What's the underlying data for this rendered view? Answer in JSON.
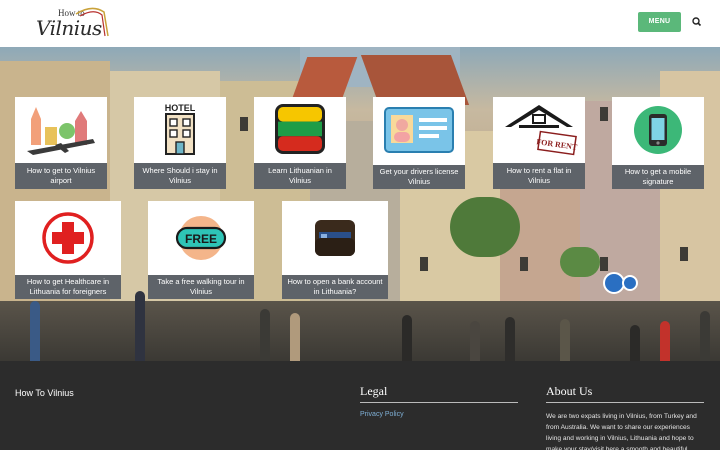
{
  "header": {
    "logo_small": "How to",
    "logo_big": "Vilnius",
    "menu_label": "MENU",
    "search_icon": "search-icon"
  },
  "tiles": [
    {
      "label": "How to get to Vilnius airport",
      "icon": "airport-skyline-icon"
    },
    {
      "label": "Where Should i stay in Vilnius",
      "icon": "hotel-icon",
      "icon_text": "HOTEL"
    },
    {
      "label": "Learn Lithuanian in Vilnius",
      "icon": "lithuania-flag-icon"
    },
    {
      "label": "Get your drivers license Vilnius",
      "icon": "drivers-license-icon"
    },
    {
      "label": "How to rent a flat in Vilnius",
      "icon": "house-for-rent-icon",
      "icon_text": "FOR RENT"
    },
    {
      "label": "How to get a mobile signature",
      "icon": "mobile-phone-icon"
    },
    {
      "label": "How to get Healthcare in Lithuania for foreigners",
      "icon": "red-cross-icon"
    },
    {
      "label": "Take a free walking tour in Vilnius",
      "icon": "free-badge-icon",
      "icon_text": "FREE"
    },
    {
      "label": "How to open a bank account in Lithuania?",
      "icon": "wallet-icon"
    }
  ],
  "footer": {
    "site_title": "How To Vilnius",
    "legal_heading": "Legal",
    "privacy_link": "Privacy Policy",
    "about_heading": "About Us",
    "about_text": "We are two expats living in Vilnius, from Turkey and from Australia. We want to share our experiences living and working in Vilnius, Lithuania and hope to make your stay/visit here a smooth and beautiful"
  },
  "colors": {
    "accent_green": "#5bb87a",
    "caption_bg": "#50565c",
    "footer_bg": "#2c2c2c",
    "link_blue": "#7fb0d6"
  }
}
